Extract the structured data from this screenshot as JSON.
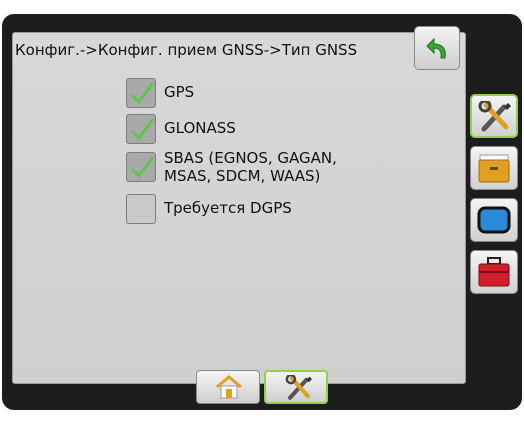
{
  "header": {
    "title": "Конфиг.->Конфиг. прием GNSS->Тип GNSS"
  },
  "options": [
    {
      "label": "GPS",
      "checked": true
    },
    {
      "label": "GLONASS",
      "checked": true
    },
    {
      "label": "SBAS (EGNOS, GAGAN,",
      "label2": "MSAS, SDCM, WAAS)",
      "checked": true
    },
    {
      "label": "Требуется DGPS",
      "checked": false
    }
  ],
  "icons": {
    "back": "back-arrow-icon",
    "side": [
      "tools-icon",
      "drawer-icon",
      "display-icon",
      "toolbox-icon"
    ],
    "bottom": [
      "home-icon",
      "tools-icon"
    ]
  },
  "colors": {
    "accent": "#8fd14f",
    "check": "#5fc44a",
    "back_arrow": "#3aa83a",
    "toolbox": "#d01e2a"
  }
}
